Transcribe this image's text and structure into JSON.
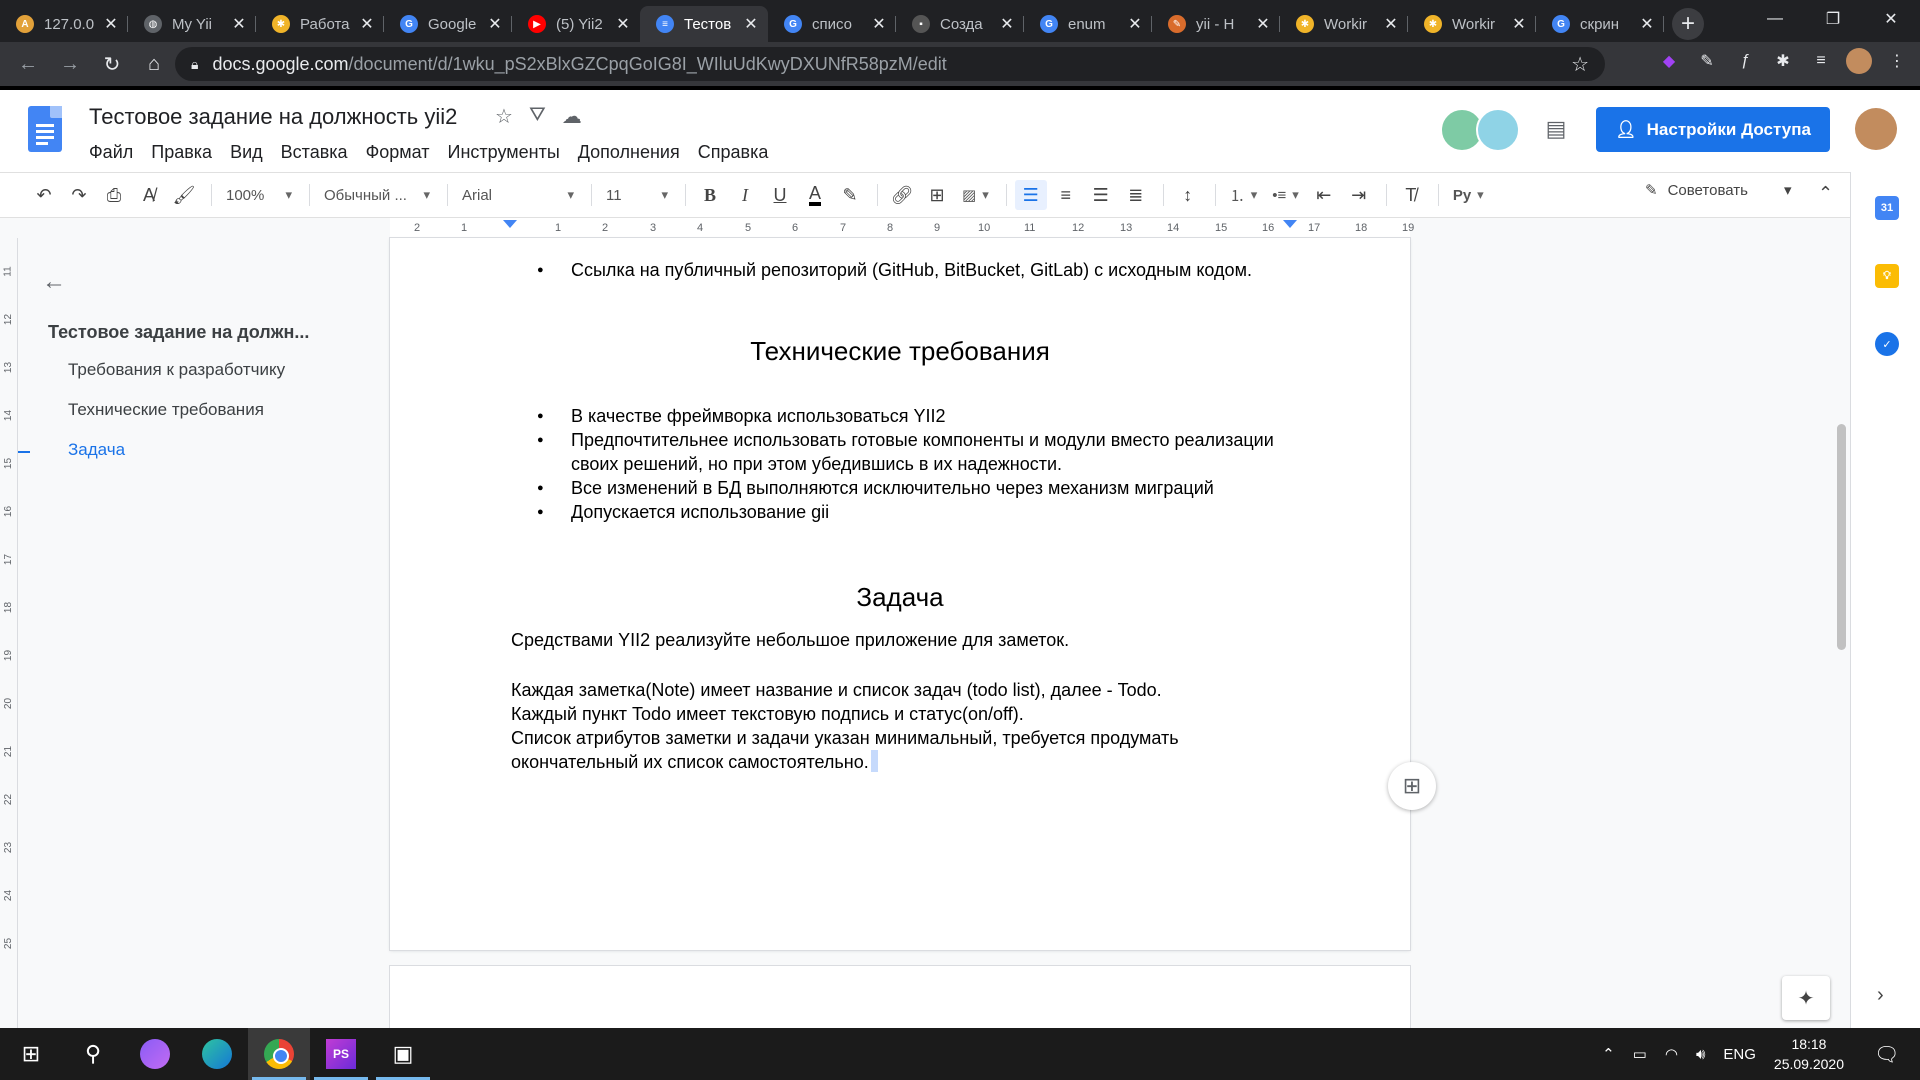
{
  "browser": {
    "tabs": [
      {
        "title": "127.0.0",
        "color": "#e2a13a",
        "glyph": "A"
      },
      {
        "title": "My Yii",
        "color": "#5f6368",
        "glyph": "◍"
      },
      {
        "title": "Работа",
        "color": "#f0b429",
        "glyph": "✱"
      },
      {
        "title": "Google",
        "color": "#4285f4",
        "glyph": "G"
      },
      {
        "title": "(5) Yii2",
        "color": "#ff0000",
        "glyph": "▶"
      },
      {
        "title": "Тестов",
        "color": "#4285f4",
        "glyph": "≡"
      },
      {
        "title": "списо",
        "color": "#4285f4",
        "glyph": "G"
      },
      {
        "title": "Созда",
        "color": "#555",
        "glyph": "▪"
      },
      {
        "title": "enum",
        "color": "#4285f4",
        "glyph": "G"
      },
      {
        "title": "yii - H",
        "color": "#d96c2c",
        "glyph": "✎"
      },
      {
        "title": "Workir",
        "color": "#f0b429",
        "glyph": "✱"
      },
      {
        "title": "Workir",
        "color": "#f0b429",
        "glyph": "✱"
      },
      {
        "title": "скрин",
        "color": "#4285f4",
        "glyph": "G"
      }
    ],
    "url_host": "docs.google.com",
    "url_path": "/document/d/1wku_pS2xBlxGZCpqGoIG8I_WIluUdKwyDXUNfR58pzM/edit"
  },
  "docs": {
    "title": "Тестовое задание на должность yii2",
    "menu": [
      "Файл",
      "Правка",
      "Вид",
      "Вставка",
      "Формат",
      "Инструменты",
      "Дополнения",
      "Справка"
    ],
    "share_label": "Настройки Доступа",
    "toolbar": {
      "zoom": "100%",
      "style": "Обычный ...",
      "font": "Arial",
      "size": "11",
      "suggest_label": "Советовать"
    }
  },
  "ruler": [
    "2",
    "1",
    "1",
    "2",
    "3",
    "4",
    "5",
    "6",
    "7",
    "8",
    "9",
    "10",
    "11",
    "12",
    "13",
    "14",
    "15",
    "16",
    "17",
    "18",
    "19"
  ],
  "vruler": [
    "11",
    "12",
    "13",
    "14",
    "15",
    "16",
    "17",
    "18",
    "19",
    "20",
    "21",
    "22",
    "23",
    "24",
    "25"
  ],
  "outline": {
    "title": "Тестовое задание на должн...",
    "items": [
      "Требования к разработчику",
      "Технические требования",
      "Задача"
    ],
    "active_index": 2
  },
  "page": {
    "top_bullet": "Ссылка на публичный репозиторий (GitHub, BitBucket, GitLab) с исходным кодом.",
    "heading1": "Технические требования",
    "bullets": [
      "В качестве фреймворка использоваться YII2",
      "Предпочтительнее использовать готовые компоненты и модули вместо реализации своих решений, но при этом убедившись в их надежности.",
      "Все изменений в БД выполняются исключительно через механизм миграций",
      "Допускается использование gii"
    ],
    "heading2": "Задача",
    "intro": "Средствами YII2 реализуйте небольшое приложение для заметок.",
    "para_lines": [
      "Каждая заметка(Note) имеет название и список задач (todo list), далее - Todo.",
      "Каждый пункт Todo имеет текстовую подпись и статус(on/off).",
      "Список атрибутов заметки и задачи указан минимальный, требуется продумать",
      "окончательный их список самостоятельно."
    ]
  },
  "taskbar": {
    "lang": "ENG",
    "time": "18:18",
    "date": "25.09.2020",
    "ps_label": "PS"
  }
}
